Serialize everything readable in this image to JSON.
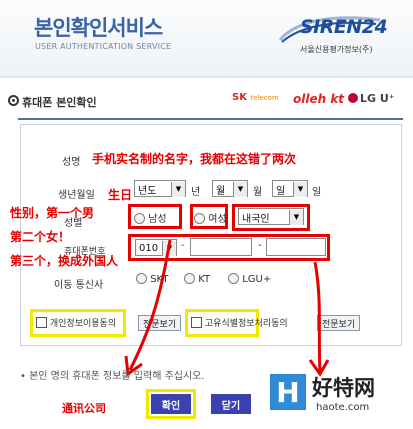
{
  "header": {
    "title_ko": "본인확인서비스",
    "title_en": "USER AUTHENTICATION SERVICE",
    "brand_logo": "SIREN24",
    "brand_sub": "서울신용평가정보(주)"
  },
  "section": {
    "title": "휴대폰 본인확인",
    "carriers": {
      "sk": "SK",
      "sk_small": "telecom",
      "kt": "olleh kt",
      "lg": "LG U⁺"
    }
  },
  "form": {
    "name_label": "성명",
    "birth_label": "생년월일",
    "birth": {
      "year": "년도",
      "year_unit": "년",
      "month": "월",
      "month_unit": "월",
      "day": "일",
      "day_unit": "일"
    },
    "gender_label": "성별",
    "gender_options": [
      "남성",
      "여성"
    ],
    "nationality": "내국인",
    "phone_label": "휴대폰번호",
    "phone_prefix": "010",
    "phone_dash": "-",
    "carrier_label": "이동 통신사",
    "carrier_options": [
      "SKT",
      "KT",
      "LGU+"
    ],
    "agree1_label": "개인정보이용동의",
    "agree1_view": "전문보기",
    "agree2_label": "고유식별정보처리동의",
    "agree2_view": "전문보기"
  },
  "notice": "• 본인 명의 휴대폰 정보를 입력해 주십시오.",
  "buttons": {
    "confirm": "확인",
    "close": "닫기"
  },
  "annotations": {
    "name_note": "手机实名制的名字，我都在这错了两次",
    "birth_note": "生日",
    "gender_note1": "性别，第一个男",
    "gender_note2": "第二个女！",
    "nationality_note": "第三个，换成外国人",
    "carrier_note": "通讯公司"
  },
  "watermark": {
    "text": "好特网",
    "url": "haote.com",
    "logo_letter": "H"
  },
  "colors": {
    "accent": "#3c41b0",
    "annotation_red": "#e60000",
    "highlight_yellow": "#f5e600",
    "brand_blue": "#1e4f9c"
  }
}
